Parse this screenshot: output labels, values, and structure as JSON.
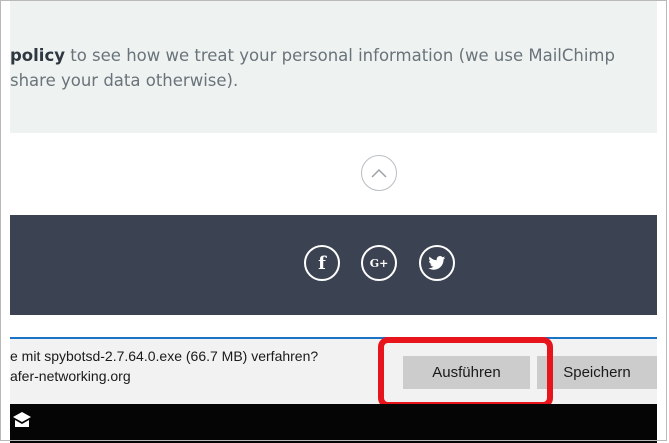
{
  "policy": {
    "bold": "policy",
    "line1_rest": " to see how we treat your personal information (we use MailChimp",
    "line2": "share your data otherwise)."
  },
  "scroll_top": {
    "icon": "chevron-up-icon"
  },
  "social": [
    {
      "icon": "facebook-icon",
      "glyph": "f"
    },
    {
      "icon": "google-plus-icon",
      "glyph": "G+"
    },
    {
      "icon": "twitter-icon",
      "glyph": "🐦"
    }
  ],
  "download": {
    "line1": "e mit spybotsd-2.7.64.0.exe (66.7 MB) verfahren?",
    "line2": "afer-networking.org",
    "run_label": "Ausführen",
    "save_label": "Speichern"
  },
  "colors": {
    "footer": "#3b4352",
    "policy_band": "#eef3f2",
    "highlight": "#e8141c",
    "download_accent": "#1a73c7"
  },
  "taskbar": {
    "icon": "start-icon"
  }
}
